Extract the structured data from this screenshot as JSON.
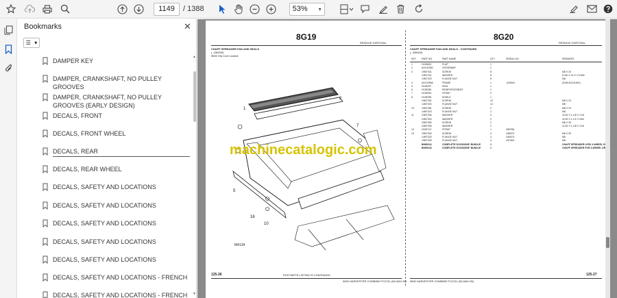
{
  "toolbar": {
    "current_page": "1149",
    "total_pages": "/ 1388",
    "zoom": "53%"
  },
  "bookmarks": {
    "title": "Bookmarks",
    "items": [
      {
        "label": "DAMPER KEY"
      },
      {
        "label": "DAMPER, CRANKSHAFT, NO PULLEY GROOVES"
      },
      {
        "label": "DAMPER, CRANKSHAFT, NO PULLEY GROOVES (EARLY DESIGN)"
      },
      {
        "label": "DECALS, FRONT"
      },
      {
        "label": "DECALS, FRONT WHEEL"
      },
      {
        "label": "DECALS, REAR"
      },
      {
        "label": "DECALS, REAR WHEEL"
      },
      {
        "label": "DECALS, SAFETY AND LOCATIONS"
      },
      {
        "label": "DECALS, SAFETY AND LOCATIONS"
      },
      {
        "label": "DECALS, SAFETY AND LOCATIONS"
      },
      {
        "label": "DECALS, SAFETY AND LOCATIONS"
      },
      {
        "label": "DECALS, SAFETY AND LOCATIONS"
      },
      {
        "label": "DECALS, SAFETY AND LOCATIONS - FRENCH"
      },
      {
        "label": "DECALS, SAFETY AND LOCATIONS - FRENCH"
      }
    ]
  },
  "document": {
    "left_page_id": "8G19",
    "right_page_id": "8G20",
    "left_section": "RESIDUE DISPOSAL",
    "right_section": "RESIDUE DISPOSAL",
    "left_title": "CHAFF SPREADER FAN AND SEALS",
    "right_title": "CHAFF SPREADER FAN AND SEALS - CONTINUED",
    "serial": "( -436000)",
    "serial_right": "( -436000)",
    "left_meta": "9600 Hia        Cont Lsnddz",
    "illustration_id": "M4134",
    "watermark": "machinecatalogic.com",
    "left_footer_num": "125-26",
    "right_footer_num": "125-27",
    "left_footer_mid": "THIS PARTS LISTING IS CONTINUED",
    "left_footer_right": "9600 HARVESTER COMBINE  PC2741  (06-MAY-95)",
    "right_footer_left": "9600 HARVESTER COMBINE  PC2741  (06-MAY-95)",
    "table_headers": [
      "KEY",
      "PART NO.",
      "PART NAME",
      "QTY",
      "SERIAL NO.",
      "REMARKS"
    ],
    "rows": [
      [
        "1",
        "H153843",
        "FLAP",
        "1",
        "",
        ""
      ],
      [
        "2",
        "AH132360",
        "CROSSBAR",
        "1",
        "",
        ""
      ],
      [
        "3",
        "19M7331",
        "SCREW",
        "8",
        "",
        "M8 X 20"
      ],
      [
        "",
        "24M7151",
        "WASHER",
        "8",
        "",
        "8.4ID X 24 X 2.5 MM"
      ],
      [
        "",
        "14M7323",
        "FLANGE NUT",
        "8",
        "",
        "M8"
      ],
      [
        "4",
        "AH132568",
        "FRAME",
        "1",
        "-443504",
        "(SUB AH141501)"
      ],
      [
        "5",
        "H135257",
        "SEAL",
        "1",
        "",
        ""
      ],
      [
        "6",
        "H135256",
        "REINFORCEMENT",
        "1",
        "",
        ""
      ],
      [
        "7",
        "H135254",
        "STRAP",
        "2",
        "",
        ""
      ],
      [
        "8",
        "H135255",
        "SHIELD",
        "1",
        "",
        ""
      ],
      [
        "",
        "19M7331",
        "SCREW",
        "10",
        "",
        "M8 X 20"
      ],
      [
        "",
        "14M7323",
        "FLANGE NUT",
        "12",
        "",
        "M8"
      ],
      [
        "10",
        "19M7381",
        "SCREW",
        "2",
        "",
        "M8 X 20"
      ],
      [
        "",
        "14M7323",
        "FLANGE NUT",
        "2",
        "",
        "M8"
      ],
      [
        "11",
        "24M7336",
        "WASHER",
        "4",
        "",
        "11/32 X 1-1/8 X 1/16"
      ],
      [
        "",
        "24M7315",
        "WASHER",
        "2",
        "",
        "11/32 X 1-1/2 X 3/64"
      ],
      [
        "",
        "19M7363",
        "SCREW",
        "2",
        "",
        "M8 X 30"
      ],
      [
        "",
        "24M7336",
        "WASHER",
        "2",
        "",
        "11/32 X 1-1/8 X 1/16"
      ],
      [
        "12",
        "H163714",
        "STRAP",
        "1",
        "436786-",
        ""
      ],
      [
        "13",
        "19M7309",
        "SCREW",
        "4",
        "436979-",
        "M8 X 30"
      ],
      [
        "",
        "14M7323",
        "FLANGE NUT",
        "4",
        "436979-",
        "M8"
      ],
      [
        "",
        "19M7325",
        "FLANGE NUT",
        "4",
        "437064-",
        "M8"
      ],
      [
        "",
        "BH89241",
        "COMPLETE GOODS/INF. BUNDLE",
        "1",
        "",
        "CHAFF SPREADER LESS 4-WHEEL DRIVE"
      ],
      [
        "",
        "BH89242",
        "COMPLETE GOODS/INF. BUNDLE",
        "1",
        "",
        "CHAFF SPREADER FOR 4-WHEEL DRIVE"
      ]
    ]
  }
}
